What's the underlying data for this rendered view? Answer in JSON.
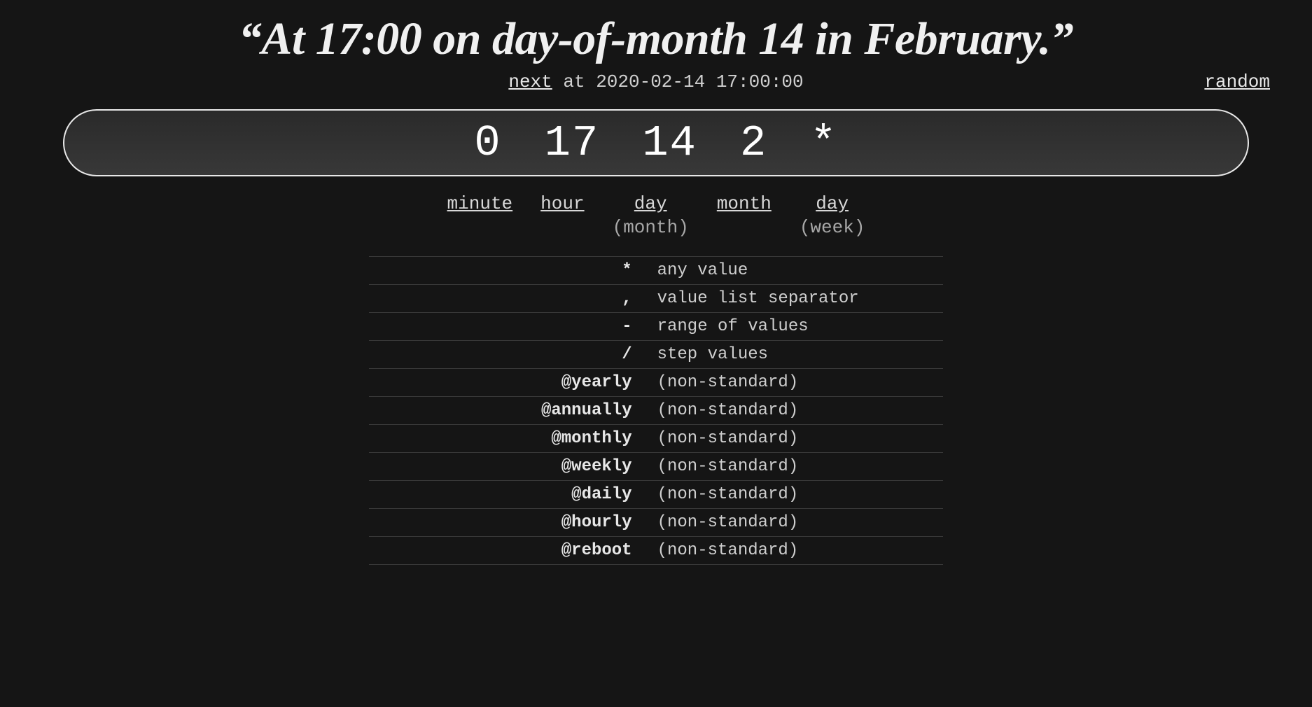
{
  "description": "“At 17:00 on day-of-month 14 in February.”",
  "next": {
    "link_label": "next",
    "prefix": " at ",
    "timestamp": "2020-02-14 17:00:00"
  },
  "random_label": "random",
  "cron_expression": "0 17 14 2 *",
  "fields": {
    "minute": {
      "label": "minute",
      "sub": ""
    },
    "hour": {
      "label": "hour",
      "sub": ""
    },
    "day_month": {
      "label": "day",
      "sub": "(month)"
    },
    "month": {
      "label": "month",
      "sub": ""
    },
    "day_week": {
      "label": "day",
      "sub": "(week)"
    }
  },
  "reference": [
    {
      "symbol": "*",
      "desc": "any value"
    },
    {
      "symbol": ",",
      "desc": "value list separator"
    },
    {
      "symbol": "-",
      "desc": "range of values"
    },
    {
      "symbol": "/",
      "desc": "step values"
    },
    {
      "symbol": "@yearly",
      "desc": "(non-standard)"
    },
    {
      "symbol": "@annually",
      "desc": "(non-standard)"
    },
    {
      "symbol": "@monthly",
      "desc": "(non-standard)"
    },
    {
      "symbol": "@weekly",
      "desc": "(non-standard)"
    },
    {
      "symbol": "@daily",
      "desc": "(non-standard)"
    },
    {
      "symbol": "@hourly",
      "desc": "(non-standard)"
    },
    {
      "symbol": "@reboot",
      "desc": "(non-standard)"
    }
  ]
}
